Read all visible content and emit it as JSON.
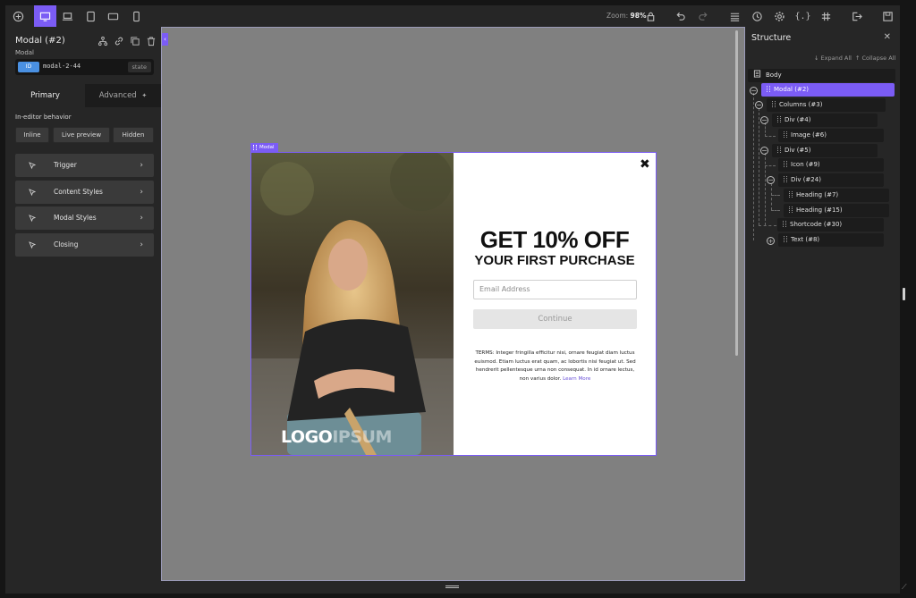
{
  "toolbar": {
    "zoom_label": "Zoom:",
    "zoom_value": "98%"
  },
  "element": {
    "title": "Modal (#2)",
    "type": "Modal",
    "id_badge": "ID",
    "id_value": "modal-2-44",
    "state_label": "state"
  },
  "panel_tabs": {
    "primary": "Primary",
    "advanced": "Advanced"
  },
  "behavior": {
    "label": "In-editor behavior",
    "options": [
      "Inline",
      "Live preview",
      "Hidden"
    ]
  },
  "accordions": [
    "Trigger",
    "Content Styles",
    "Modal Styles",
    "Closing"
  ],
  "modal_preview": {
    "tag": "Modal",
    "logo_part1": "LOGO",
    "logo_part2": "IPSUM",
    "close_glyph": "✖",
    "headline": "GET 10% OFF",
    "subheadline": "YOUR FIRST PURCHASE",
    "email_placeholder": "Email Address",
    "button_label": "Continue",
    "terms_text": "TERMS: Integer fringilla efficitur nisi, ornare feugiat diam luctus euismod. Etiam luctus erat quam, ac lobortis nisi feugiat ut. Sed hendrerit pellentesque urna non consequat. In id ornare lectus, non varius dolor.",
    "terms_link": "Learn More"
  },
  "structure": {
    "title": "Structure",
    "expand_all": "↓ Expand All",
    "collapse_all": "↑ Collapse All",
    "nodes": [
      {
        "label": "Body"
      },
      {
        "label": "Modal (#2)"
      },
      {
        "label": "Columns (#3)"
      },
      {
        "label": "Div (#4)"
      },
      {
        "label": "Image (#6)"
      },
      {
        "label": "Div (#5)"
      },
      {
        "label": "Icon (#9)"
      },
      {
        "label": "Div (#24)"
      },
      {
        "label": "Heading (#7)"
      },
      {
        "label": "Heading (#15)"
      },
      {
        "label": "Shortcode (#30)"
      },
      {
        "label": "Text (#8)"
      }
    ]
  },
  "colors": {
    "accent": "#7b5cf5",
    "id_badge": "#4a90e2",
    "panel": "#262626",
    "canvas": "#808080"
  }
}
